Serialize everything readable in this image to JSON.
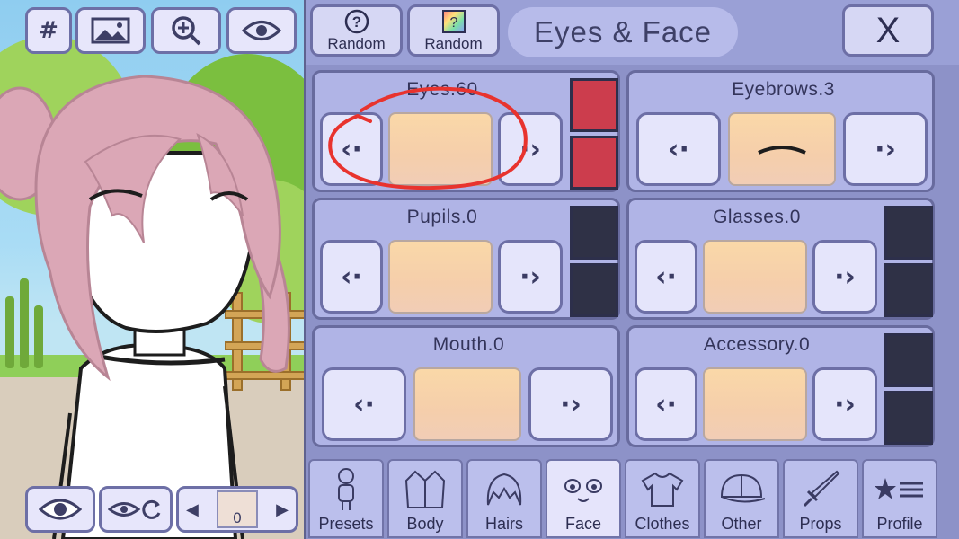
{
  "scene": {
    "top_buttons": [
      {
        "name": "grid-button",
        "icon": "hash-icon",
        "label": "#"
      },
      {
        "name": "background-button",
        "icon": "image-icon"
      },
      {
        "name": "zoom-button",
        "icon": "zoom-in-icon"
      },
      {
        "name": "visibility-button",
        "icon": "eye-icon"
      }
    ],
    "bottom_controls": {
      "eye_button_icon": "eye-icon",
      "reset_eye_icon": "eye-rotate-icon",
      "stepper_value": "0"
    }
  },
  "header": {
    "random_buttons": [
      {
        "icon": "question-icon",
        "label": "Random"
      },
      {
        "icon": "rainbow-card-icon",
        "label": "Random"
      }
    ],
    "title": "Eyes & Face",
    "close_label": "X"
  },
  "features": [
    {
      "label": "Eyes.60",
      "has_colors": true,
      "colors": [
        "#cc3d4d",
        "#cc3d4d"
      ]
    },
    {
      "label": "Eyebrows.3",
      "has_colors": false
    },
    {
      "label": "Pupils.0",
      "has_colors": true,
      "colors": [
        "#2f3146",
        "#2f3146"
      ]
    },
    {
      "label": "Glasses.0",
      "has_colors": true,
      "colors": [
        "#2f3146",
        "#2f3146"
      ]
    },
    {
      "label": "Mouth.0",
      "has_colors": false
    },
    {
      "label": "Accessory.0",
      "has_colors": true,
      "colors": [
        "#2f3146",
        "#2f3146"
      ]
    }
  ],
  "nav_tabs": [
    {
      "label": "Presets",
      "icon": "person-icon",
      "active": false
    },
    {
      "label": "Body",
      "icon": "jacket-icon",
      "active": false
    },
    {
      "label": "Hairs",
      "icon": "hair-icon",
      "active": false
    },
    {
      "label": "Face",
      "icon": "face-icon",
      "active": true
    },
    {
      "label": "Clothes",
      "icon": "shirt-icon",
      "active": false
    },
    {
      "label": "Other",
      "icon": "cap-icon",
      "active": false
    },
    {
      "label": "Props",
      "icon": "sword-icon",
      "active": false
    },
    {
      "label": "Profile",
      "icon": "star-list-icon",
      "active": false
    }
  ],
  "colors": {
    "accent_annotation": "#e8332e",
    "panel_bg": "#8d92c8",
    "button_bg": "#e5e5fb",
    "preview_skin": "#f5ceab"
  }
}
